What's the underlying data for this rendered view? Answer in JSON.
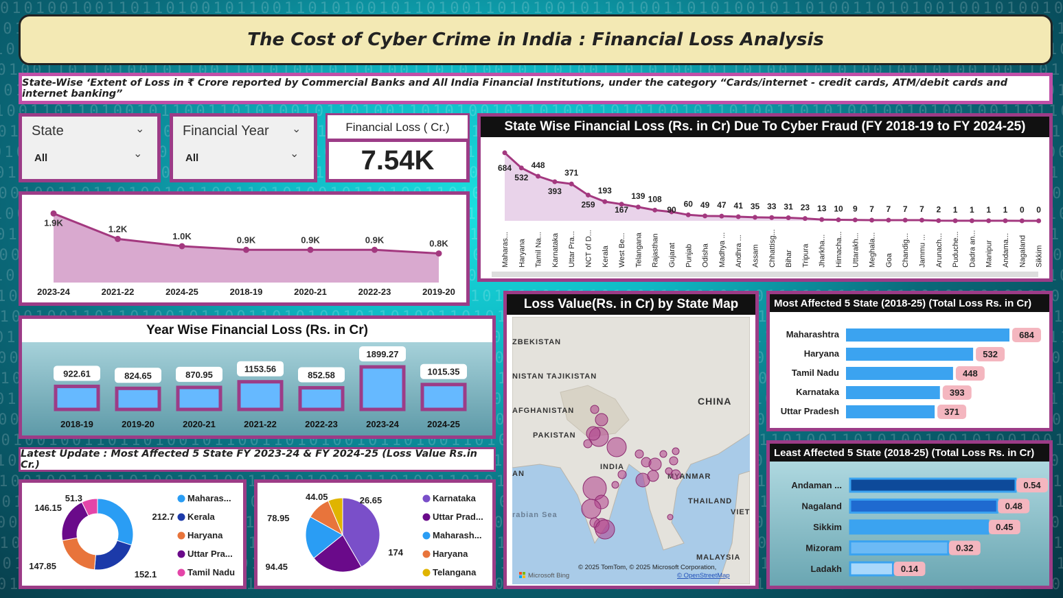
{
  "title": "The Cost of Cyber Crime in India : Financial Loss Analysis",
  "subtitle": "State-Wise ‘Extent of Loss in ₹ Crore reported by Commercial Banks and All India Financial Institutions, under the category “Cards/internet - credit cards, ATM/debit cards and internet banking”",
  "filters": {
    "state": {
      "label": "State",
      "value": "All"
    },
    "year": {
      "label": "Financial Year",
      "value": "All"
    }
  },
  "kpi": {
    "label": "Financial Loss ( Cr.)",
    "value": "7.54K"
  },
  "colors": {
    "accent": "#9c3c87",
    "bar_blue": "#3ba3f0",
    "banner": "#f3e9b4",
    "pink_label": "#f4b6bf"
  },
  "chart_data": [
    {
      "id": "year_area",
      "type": "area",
      "categories": [
        "2023-24",
        "2021-22",
        "2024-25",
        "2018-19",
        "2020-21",
        "2022-23",
        "2019-20"
      ],
      "values": [
        1.9,
        1.2,
        1.0,
        0.9,
        0.9,
        0.9,
        0.8
      ],
      "labels": [
        "1.9K",
        "1.2K",
        "1.0K",
        "0.9K",
        "0.9K",
        "0.9K",
        "0.8K"
      ]
    },
    {
      "id": "year_bars",
      "type": "bar",
      "title": "Year Wise Financial Loss (Rs. in Cr)",
      "categories": [
        "2018-19",
        "2019-20",
        "2020-21",
        "2021-22",
        "2022-23",
        "2023-24",
        "2024-25"
      ],
      "values": [
        922.61,
        824.65,
        870.95,
        1153.56,
        852.58,
        1899.27,
        1015.35
      ],
      "labels": [
        "922.61",
        "824.65",
        "870.95",
        "1153.56",
        "852.58",
        "1899.27",
        "1015.35"
      ]
    },
    {
      "id": "state_line",
      "type": "area",
      "title": "State Wise Financial Loss (Rs. in Cr) Due To Cyber Fraud (FY 2018-19 to FY 2024-25)",
      "categories": [
        "Maharas...",
        "Haryana",
        "Tamil Na...",
        "Karnataka",
        "Uttar Pra...",
        "NCT of D...",
        "Kerala",
        "West Be...",
        "Telangana",
        "Rajasthan",
        "Gujarat",
        "Punjab",
        "Odisha",
        "Madhya ...",
        "Andhra ...",
        "Assam",
        "Chhattisg...",
        "Bihar",
        "Tripura",
        "Jharkha...",
        "Himacha...",
        "Uttarakh...",
        "Meghala...",
        "Goa",
        "Chandig...",
        "Jammu ...",
        "Arunach...",
        "Puduche...",
        "Dadra an...",
        "Manipur",
        "Andama...",
        "Nagaland",
        "Sikkim"
      ],
      "values": [
        684,
        532,
        448,
        393,
        371,
        259,
        193,
        167,
        139,
        108,
        90,
        60,
        49,
        47,
        41,
        35,
        33,
        31,
        23,
        13,
        10,
        9,
        7,
        7,
        7,
        7,
        2,
        1,
        1,
        1,
        1,
        0,
        0
      ],
      "labels": [
        "684",
        "532",
        "448",
        "393",
        "371",
        "259",
        "193",
        "167",
        "139",
        "108",
        "90",
        "60",
        "49",
        "47",
        "41",
        "35",
        "33",
        "31",
        "23",
        "13",
        "10",
        "9",
        "7",
        "7",
        "7",
        "7",
        "2",
        "1",
        "1",
        "1",
        "1",
        "0",
        "0"
      ]
    },
    {
      "id": "most_affected",
      "type": "bar",
      "title": "Most Affected 5 State (2018-25) (Total Loss Rs. in Cr)",
      "categories": [
        "Maharashtra",
        "Haryana",
        "Tamil Nadu",
        "Karnataka",
        "Uttar Pradesh"
      ],
      "values": [
        684,
        532,
        448,
        393,
        371
      ],
      "labels": [
        "684",
        "532",
        "448",
        "393",
        "371"
      ]
    },
    {
      "id": "least_affected",
      "type": "bar",
      "title": "Least Affected 5 State (2018-25) (Total Loss Rs. in Cr)",
      "categories": [
        "Andaman ...",
        "Nagaland",
        "Sikkim",
        "Mizoram",
        "Ladakh"
      ],
      "values": [
        0.54,
        0.48,
        0.45,
        0.32,
        0.14
      ],
      "labels": [
        "0.54",
        "0.48",
        "0.45",
        "0.32",
        "0.14"
      ]
    },
    {
      "id": "donut_2023",
      "type": "pie",
      "categories": [
        "Maharas...",
        "Kerala",
        "Haryana",
        "Uttar Pra...",
        "Tamil Nadu"
      ],
      "values": [
        212.7,
        152.1,
        147.85,
        146.15,
        51.3
      ],
      "labels": [
        "212.7",
        "152.1",
        "147.85",
        "146.15",
        "51.3"
      ],
      "colors": [
        "#2a9df4",
        "#1c3aa9",
        "#e8743b",
        "#6a0a8a",
        "#e445a8"
      ]
    },
    {
      "id": "pie_2024",
      "type": "pie",
      "categories": [
        "Karnataka",
        "Uttar Prad...",
        "Maharash...",
        "Haryana",
        "Telangana"
      ],
      "values": [
        174,
        94.45,
        78.95,
        44.05,
        26.65
      ],
      "labels": [
        "174",
        "94.45",
        "78.95",
        "44.05",
        "26.65"
      ],
      "colors": [
        "#7a4fc9",
        "#6a0a8a",
        "#2a9df4",
        "#e8743b",
        "#e0b400"
      ]
    }
  ],
  "year_bars_title": "Year Wise Financial Loss (Rs. in Cr)",
  "state_title": "State Wise Financial Loss (Rs. in Cr) Due To Cyber Fraud (FY 2018-19 to FY 2024-25)",
  "map": {
    "title": "Loss Value(Rs. in Cr) by State Map",
    "labels": [
      "ZBEKISTAN",
      "NISTAN",
      "TAJIKISTAN",
      "AFGHANISTAN",
      "PAKISTAN",
      "CHINA",
      "INDIA",
      "MYANMAR",
      "THAILAND",
      "VIETI",
      "rabian Sea",
      "MALAYSIA",
      "AN"
    ],
    "copyright": "© 2025 TomTom, © 2025 Microsoft Corporation,",
    "osm": "© OpenStreetMap",
    "bing": "Microsoft Bing"
  },
  "most_title": "Most Affected 5 State (2018-25) (Total Loss Rs. in Cr)",
  "least_title": "Least Affected 5 State (2018-25) (Total Loss Rs. in Cr)",
  "latest_update": "Latest Update : Most Affected 5 State FY 2023-24  & FY 2024-25 (Loss Value Rs.in Cr.)"
}
